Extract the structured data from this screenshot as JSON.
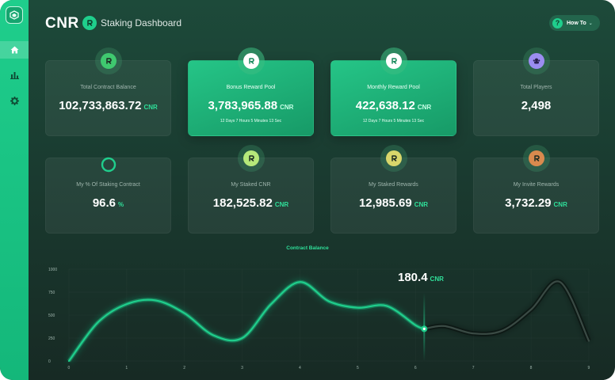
{
  "header": {
    "brand": "CNR",
    "subtitle": "Staking Dashboard",
    "how_to_label": "How To"
  },
  "sidebar": {
    "items": [
      {
        "icon": "home-icon",
        "active": true
      },
      {
        "icon": "bar-chart-icon",
        "active": false
      },
      {
        "icon": "gear-icon",
        "active": false
      }
    ]
  },
  "cards": [
    {
      "label": "Total Contract Balance",
      "value": "102,733,863.72",
      "unit": "CNR",
      "highlight": false,
      "icon": "cnr-logo-icon",
      "icon_color": "#3fc96f"
    },
    {
      "label": "Bonus Reward Pool",
      "value": "3,783,965.88",
      "unit": "CNR",
      "highlight": true,
      "icon": "cnr-logo-icon",
      "icon_color": "#1a7a52",
      "timer": "12 Days  7 Hours  5 Minutes  13 Sec"
    },
    {
      "label": "Monthly Reward Pool",
      "value": "422,638.12",
      "unit": "CNR",
      "highlight": true,
      "icon": "cnr-logo-icon",
      "icon_color": "#1a7a52",
      "timer": "12 Days  7 Hours  5 Minutes  13 Sec"
    },
    {
      "label": "Total Players",
      "value": "2,498",
      "unit": "",
      "highlight": false,
      "icon": "players-icon",
      "icon_color": "#9b8df0"
    },
    {
      "label": "My % Of Staking Contract",
      "value": "96.6",
      "unit": "%",
      "highlight": false,
      "icon": "progress-ring-icon",
      "icon_color": "#1fce8c",
      "progress": 0.966
    },
    {
      "label": "My Staked CNR",
      "value": "182,525.82",
      "unit": "CNR",
      "highlight": false,
      "icon": "cnr-logo-icon",
      "icon_color": "#b6e87a"
    },
    {
      "label": "My Staked Rewards",
      "value": "12,985.69",
      "unit": "CNR",
      "highlight": false,
      "icon": "cnr-logo-icon",
      "icon_color": "#d8d66b"
    },
    {
      "label": "My Invite Rewards",
      "value": "3,732.29",
      "unit": "CNR",
      "highlight": false,
      "icon": "cnr-logo-icon",
      "icon_color": "#d98a4e"
    }
  ],
  "chart_data": {
    "type": "line",
    "title": "Contract Balance",
    "x": [
      0,
      0.5,
      1,
      1.5,
      2,
      2.5,
      3,
      3.5,
      4,
      4.5,
      5,
      5.5,
      6,
      6.15,
      6.5,
      7,
      7.5,
      8,
      8.5,
      9
    ],
    "series": [
      {
        "values": [
          0,
          420,
          620,
          660,
          520,
          280,
          250,
          620,
          860,
          650,
          580,
          600,
          390,
          350,
          380,
          300,
          330,
          560,
          860,
          220
        ]
      }
    ],
    "highlight_x": 6.15,
    "highlight_value": "180.4",
    "highlight_unit": "CNR",
    "xticks": [
      "0",
      "1",
      "2",
      "3",
      "4",
      "5",
      "6",
      "7",
      "8",
      "9"
    ],
    "yticks": [
      "0",
      "250",
      "500",
      "750",
      "1000"
    ],
    "xlim": [
      0,
      9
    ],
    "ylim": [
      0,
      1000
    ],
    "line_color": "#1fce8c",
    "future_color": "#3a4a44"
  }
}
